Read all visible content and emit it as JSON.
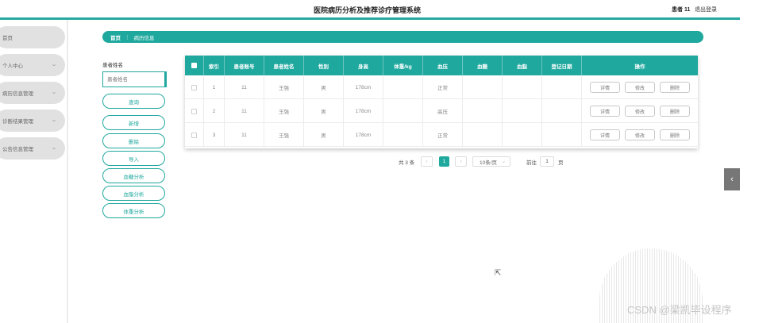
{
  "header": {
    "title": "医院病历分析及推荐诊疗管理系统",
    "user": "患者 11",
    "logout": "退出登录"
  },
  "sidebar": {
    "items": [
      {
        "label": "首页",
        "has_children": false
      },
      {
        "label": "个人中心",
        "has_children": true
      },
      {
        "label": "病历信息管理",
        "has_children": true
      },
      {
        "label": "诊断结果管理",
        "has_children": true
      },
      {
        "label": "公告信息管理",
        "has_children": true
      }
    ]
  },
  "breadcrumb": {
    "home": "首页",
    "separator": "⋮",
    "current": "病历信息"
  },
  "filter": {
    "label": "患者姓名",
    "placeholder": "患者姓名",
    "search_btn": "查询"
  },
  "actions": {
    "add": "新增",
    "delete": "删除",
    "import": "导入",
    "blood_sugar": "血糖分析",
    "blood_lipid": "血脂分析",
    "weight": "体重分析"
  },
  "table": {
    "columns": [
      "索引",
      "患者账号",
      "患者姓名",
      "性别",
      "身高",
      "体重/kg",
      "血压",
      "血糖",
      "血脂",
      "登记日期",
      "操作"
    ],
    "rows": [
      {
        "index": "1",
        "account": "11",
        "name": "王强",
        "gender": "男",
        "height": "178cm",
        "weight": "",
        "bp": "正常",
        "sugar": "",
        "lipid": "",
        "date": ""
      },
      {
        "index": "2",
        "account": "11",
        "name": "王强",
        "gender": "男",
        "height": "178cm",
        "weight": "",
        "bp": "高压",
        "sugar": "",
        "lipid": "",
        "date": ""
      },
      {
        "index": "3",
        "account": "11",
        "name": "王强",
        "gender": "男",
        "height": "178cm",
        "weight": "",
        "bp": "正常",
        "sugar": "",
        "lipid": "",
        "date": ""
      }
    ],
    "row_buttons": {
      "detail": "详情",
      "edit": "修改",
      "delete": "删除"
    }
  },
  "pagination": {
    "total": "共 3 条",
    "prev": "‹",
    "current_page": "1",
    "next": "›",
    "page_size": "10条/页",
    "goto_label": "前往",
    "goto_value": "1",
    "page_unit": "页"
  },
  "side_toggle": "‹",
  "watermark": "CSDN @梁凯毕设程序",
  "colors": {
    "accent": "#1fa89e",
    "sidebar_item": "#e2e1e1"
  }
}
